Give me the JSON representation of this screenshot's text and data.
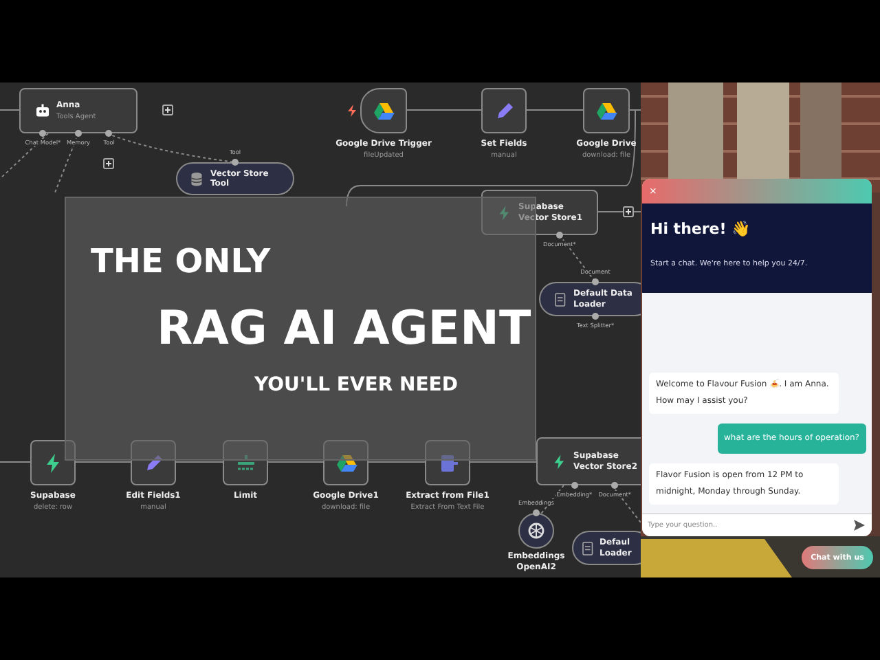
{
  "workflow": {
    "nodes": [
      {
        "kind": "agent",
        "title": "Anna",
        "subtitle": "Tools Agent",
        "ports": [
          "Chat Model*",
          "Memory",
          "Tool"
        ]
      },
      {
        "kind": "pill",
        "title": "Vector Store Tool",
        "inputs": [
          "Tool"
        ]
      },
      {
        "kind": "trigger",
        "title": "Google Drive Trigger",
        "subtitle": "fileUpdated"
      },
      {
        "kind": "box",
        "title": "Set Fields",
        "subtitle": "manual"
      },
      {
        "kind": "box",
        "title": "Google Drive",
        "subtitle": "download: file"
      },
      {
        "kind": "wide",
        "title": "Supabase Vector Store1",
        "ports": [
          "Document*"
        ]
      },
      {
        "kind": "pill",
        "title": "Default Data Loader",
        "inputs": [
          "Document"
        ],
        "ports": [
          "Text Splitter*"
        ]
      },
      {
        "kind": "box",
        "title": "Supabase",
        "subtitle": "delete: row"
      },
      {
        "kind": "box",
        "title": "Edit Fields1",
        "subtitle": "manual"
      },
      {
        "kind": "box",
        "title": "Limit"
      },
      {
        "kind": "box",
        "title": "Google Drive1",
        "subtitle": "download: file"
      },
      {
        "kind": "box",
        "title": "Extract from File1",
        "subtitle": "Extract From Text File"
      },
      {
        "kind": "wide",
        "title": "Supabase Vector Store2",
        "ports": [
          "Embedding*",
          "Document*"
        ]
      },
      {
        "kind": "circle",
        "title": "Embeddings OpenAI2",
        "inputs": [
          "Embeddings"
        ]
      },
      {
        "kind": "pill",
        "title": "Defaul Loader"
      }
    ]
  },
  "overlay": {
    "lines": [
      "THE ONLY",
      "RAG AI AGENT",
      "YOU'LL EVER NEED"
    ]
  },
  "chat": {
    "close": "×",
    "heading": "Hi there! 👋",
    "subtitle": "Start a chat. We're here to help you 24/7.",
    "messages": [
      {
        "kind": "bot",
        "text": "Welcome to Flavour Fusion 🍝. I am Anna. How may I assist you?"
      },
      {
        "kind": "user",
        "text": "what are the hours of operation?"
      },
      {
        "kind": "bot",
        "text": "Flavor Fusion is open from 12 PM to midnight, Monday through Sunday."
      }
    ],
    "input": {
      "placeholder": "Type your question.."
    },
    "launcher": "Chat with us"
  }
}
